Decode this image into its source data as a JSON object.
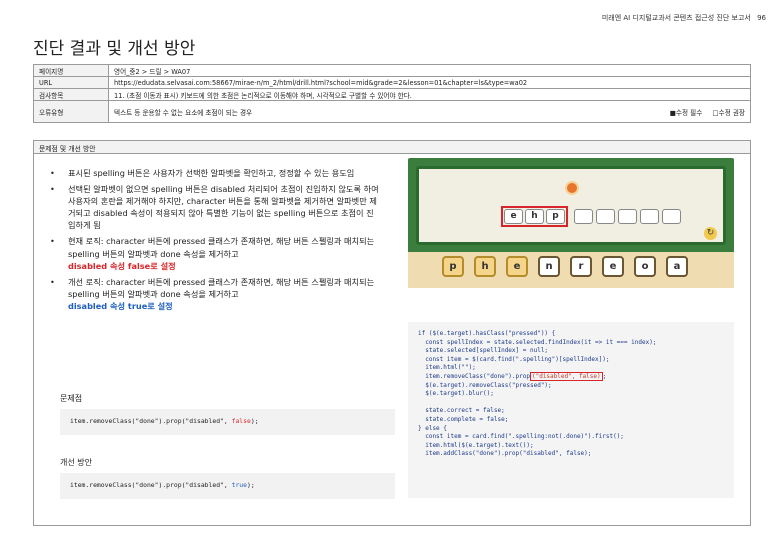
{
  "header": {
    "report_title": "미래엔 AI 디지털교과서 콘텐츠 접근성 진단 보고서",
    "page_number": "96"
  },
  "page_title": "진단 결과 및 개선 방안",
  "info": {
    "page_name_label": "페이지명",
    "page_name_value": "영어_중2 > 드릴 > WA07",
    "url_label": "URL",
    "url_value": "https://edudata.selvasai.com:58667/mirae-n/m_2/html/drill.html?school=mid&grade=2&lesson=01&chapter=ls&type=wa02",
    "check_label": "검사항목",
    "check_value": "11. (초점 이동과 표시) 키보드에 의한 초점은 논리적으로 이동해야 하며, 시각적으로 구별할 수 있어야 한다.",
    "error_label": "오류유형",
    "error_value": "텍스트 등 운용할 수 없는 요소에 초점이 되는 경우",
    "required_label": "■수정 필수",
    "recommended_label": "□수정 권장"
  },
  "main": {
    "section_title": "문제점 및 개선 방안",
    "bullets": {
      "b1": "표시된 spelling 버튼은 사용자가 선택한 알파벳을 확인하고, 정정할 수 있는 용도임",
      "b2": "선택된 알파벳이 없으면 spelling 버튼은 disabled 처리되어 초점이 진입하지 않도록 하여 사용자의 혼란을 제거해야 하지만, character 버튼을 통해 알파벳을 제거하면 알파벳만 제거되고 disabled 속성이 적용되지 않아 특별한 기능이 없는 spelling 버튼으로 초점이 진입하게 됨",
      "b3": "현재 로직: character 버튼에 pressed 클래스가 존재하면, 해당 버튼 스펠링과 매치되는 spelling 버튼의 알파벳과 done 속성을 제거하고",
      "b3_emph": "disabled 속성 false로 설정",
      "b4": "개선 로직: character 버튼에 pressed 클래스가 존재하면, 해당 버튼 스펠링과 매치되는 spelling 버튼의 알파벳과 done 속성을 제거하고",
      "b4_emph": "disabled 속성 true로 설정"
    },
    "problem_label": "문제점",
    "problem_code_prefix": "item.removeClass(\"done\").prop(\"disabled\", ",
    "problem_code_value": "false",
    "problem_code_suffix": ");",
    "improve_label": "개선 방안",
    "improve_code_prefix": "item.removeClass(\"done\").prop(\"disabled\", ",
    "improve_code_value": "true",
    "improve_code_suffix": ");"
  },
  "game": {
    "slots_filled": [
      "e",
      "h",
      "p"
    ],
    "slots_empty_count": 5,
    "tiles": [
      "p",
      "h",
      "e",
      "n",
      "r",
      "e",
      "o",
      "a"
    ],
    "tiles_used": [
      true,
      true,
      true,
      false,
      false,
      false,
      false,
      false
    ]
  },
  "code_shot": {
    "l1": "if ($(e.target).hasClass(\"pressed\")) {",
    "l2": "  const spellIndex = state.selected.findIndex(it => it === index);",
    "l3": "  state.selected[spellIndex] = null;",
    "l4": "  const item = $(card.find(\".spelling\")[spellIndex]);",
    "l5": "  item.html(\"\");",
    "l6a": "  item.removeClass(\"done\").prop",
    "l6b": "(\"disabled\", false)",
    "l6c": ";",
    "l7": "  $(e.target).removeClass(\"pressed\");",
    "l8": "  $(e.target).blur();",
    "l9": "  state.correct = false;",
    "l10": "  state.complete = false;",
    "l11": "} else {",
    "l12": "  const item = card.find(\".spelling:not(.done)\").first();",
    "l13": "  item.html($(e.target).text());",
    "l14": "  item.addClass(\"done\").prop(\"disabled\", false);"
  },
  "colors": {
    "emphasis_red": "#d6262b",
    "emphasis_blue": "#1f5fbf",
    "game_green": "#3a7d3d"
  }
}
